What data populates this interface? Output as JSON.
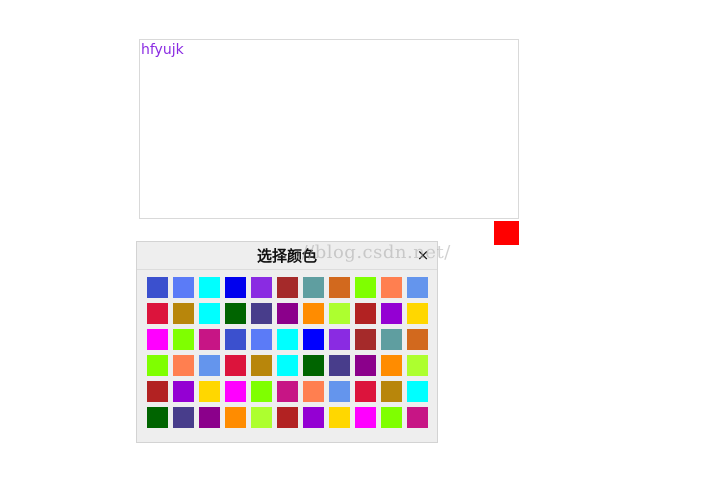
{
  "editor": {
    "text": "hfyujk",
    "text_color": "#8a2be2"
  },
  "color_trigger": {
    "color": "#ff0000"
  },
  "picker": {
    "title": "选择颜色",
    "close_label": "×",
    "rows": [
      [
        "#3b50ce",
        "#5b7bf7",
        "#00ffff",
        "#0000ee",
        "#8a2be2",
        "#a52a2a",
        "#5f9ea0",
        "#d2691e",
        "#7fff00",
        "#ff7f50",
        "#6495ed"
      ],
      [
        "#dc143c",
        "#b8860b",
        "#00ffff",
        "#006400",
        "#483d8b",
        "#8b008b",
        "#ff8c00",
        "#adff2f",
        "#b22222",
        "#9400d3",
        "#ffd700"
      ],
      [
        "#ff00ff",
        "#7fff00",
        "#c71585",
        "#3b50ce",
        "#5b7bf7",
        "#00ffff",
        "#0000ff",
        "#8a2be2",
        "#a52a2a",
        "#5f9ea0",
        "#d2691e"
      ],
      [
        "#7fff00",
        "#ff7f50",
        "#6495ed",
        "#dc143c",
        "#b8860b",
        "#00ffff",
        "#006400",
        "#483d8b",
        "#8b008b",
        "#ff8c00",
        "#adff2f"
      ],
      [
        "#b22222",
        "#9400d3",
        "#ffd700",
        "#ff00ff",
        "#7fff00",
        "#c71585",
        "#ff7f50",
        "#6495ed",
        "#dc143c",
        "#b8860b",
        "#00ffff"
      ],
      [
        "#006400",
        "#483d8b",
        "#8b008b",
        "#ff8c00",
        "#adff2f",
        "#b22222",
        "#9400d3",
        "#ffd700",
        "#ff00ff",
        "#7fff00",
        "#c71585"
      ]
    ]
  },
  "watermark": {
    "text": "://blog.csdn.net/"
  }
}
